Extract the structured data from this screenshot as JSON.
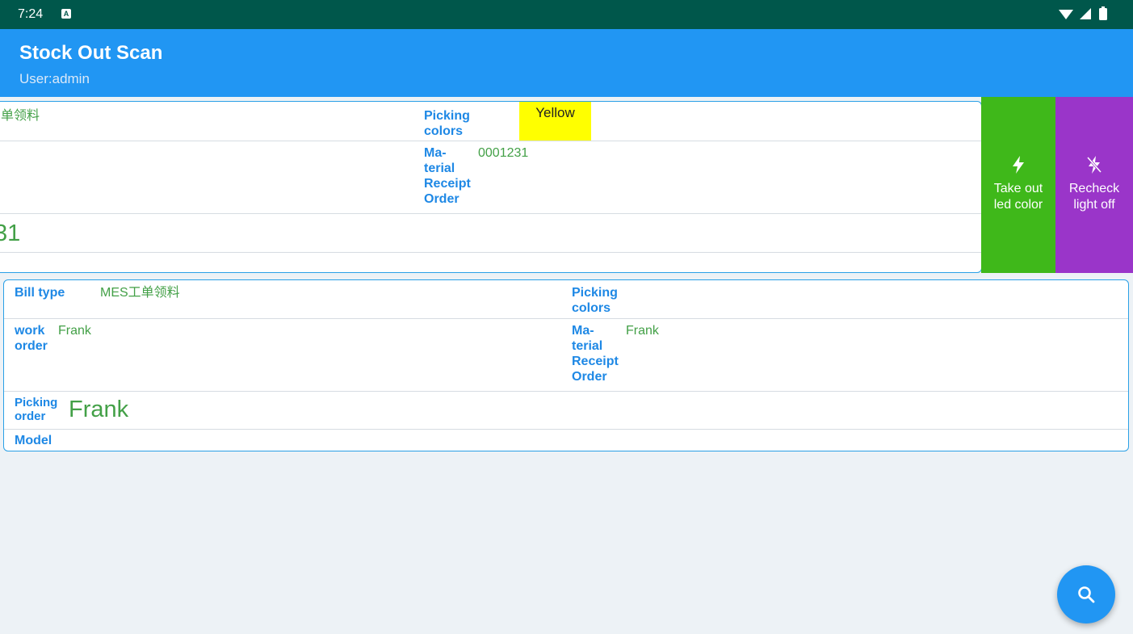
{
  "status_bar": {
    "time": "7:24",
    "notification_icon": "A",
    "system_icons": "wifi-icon signal-icon battery-icon"
  },
  "app_bar": {
    "title": "Stock Out Scan",
    "subtitle": "User:admin",
    "color": "#2196f3"
  },
  "card_top": {
    "bill_type_value": "单领料",
    "picking_colors_label": "Picking colors",
    "picking_colors_value": "Yellow",
    "picking_colors_swatch": "#ffff00",
    "receipt_label": "Ma-\nterial\nReceipt\nOrder",
    "receipt_value": "0001231",
    "picking_order_value": "31"
  },
  "card_bottom": {
    "bill_type_label": "Bill type",
    "bill_type_value": "MES工单领料",
    "picking_colors_label": "Picking colors",
    "work_order_label": "work order",
    "work_order_value": "Frank",
    "receipt_label": "Ma-\nterial\nReceipt\nOrder",
    "receipt_value": "Frank",
    "picking_order_label": "Picking order",
    "picking_order_value": "Frank",
    "model_label": "Model"
  },
  "actions": {
    "take_out_label": "Take out led color",
    "take_out_color": "#3fb81a",
    "recheck_label": "Recheck light off",
    "recheck_color": "#9a35c9"
  },
  "fab": {
    "icon": "search-icon"
  }
}
